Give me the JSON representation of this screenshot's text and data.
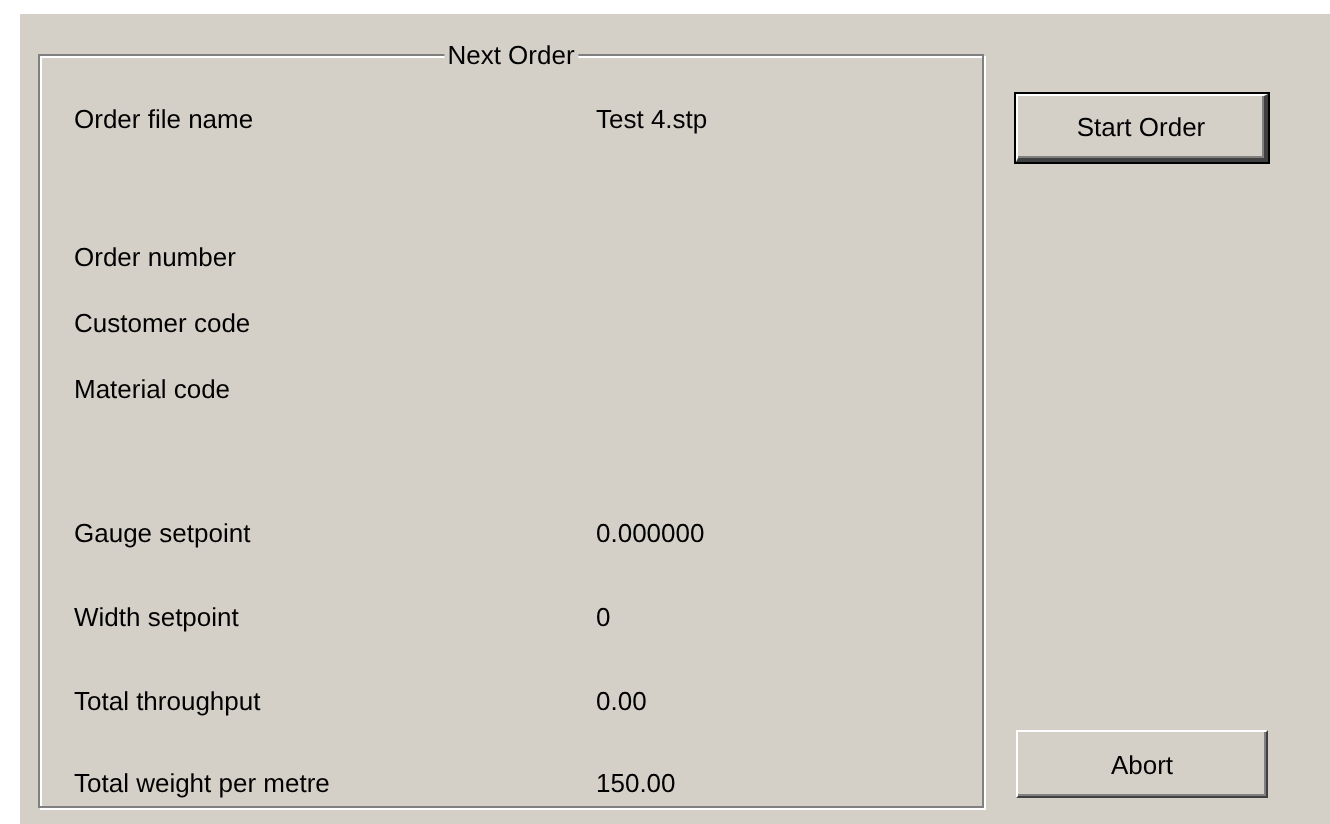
{
  "group": {
    "title": "Next Order",
    "sections": [
      [
        {
          "label": "Order file name",
          "value": "Test 4.stp"
        }
      ],
      [
        {
          "label": "Order number"
        },
        {
          "label": "Customer code"
        },
        {
          "label": "Material code"
        }
      ],
      [
        {
          "label": "Gauge setpoint",
          "value": "0.000000"
        },
        {
          "label": "Width setpoint",
          "value": "0"
        },
        {
          "label": "Total throughput",
          "value": "0.00"
        },
        {
          "label": "Total weight per metre",
          "value": "150.00"
        }
      ]
    ]
  },
  "buttons": [
    {
      "label": "Start Order",
      "default": true
    },
    {
      "label": "Abort",
      "default": false
    }
  ]
}
